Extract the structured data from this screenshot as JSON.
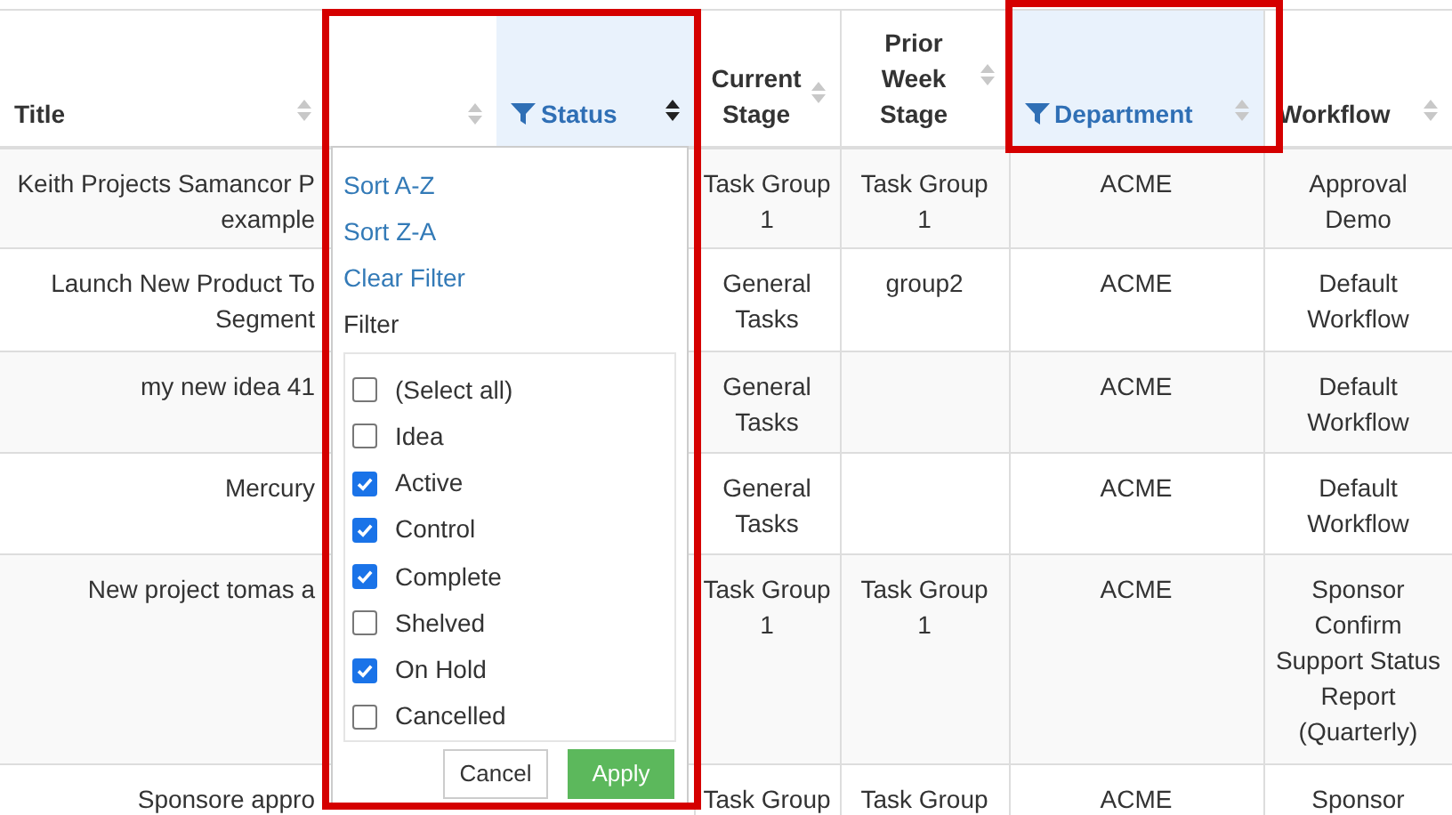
{
  "columns": [
    {
      "label": "Title",
      "filtered": false,
      "sorted": false
    },
    {
      "filtered": false,
      "sorted": false
    },
    {
      "label": "Status",
      "filtered": true,
      "sorted": true
    },
    {
      "label": "Current Stage",
      "filtered": false,
      "sorted": false
    },
    {
      "label": "Prior Week Stage",
      "filtered": false,
      "sorted": false
    },
    {
      "label": "Department",
      "filtered": true,
      "sorted": false
    },
    {
      "label": "Workflow",
      "filtered": false,
      "sorted": false
    }
  ],
  "rows": [
    {
      "title": "Keith Projects Samancor P example",
      "current_stage": "Task Group 1",
      "prior_week_stage": "Task Group 1",
      "department": "ACME",
      "workflow": "Approval Demo"
    },
    {
      "title": "Launch New Product To Segment",
      "current_stage": "General Tasks",
      "prior_week_stage": "group2",
      "department": "ACME",
      "workflow": "Default Workflow"
    },
    {
      "title": "my new idea 41",
      "current_stage": "General Tasks",
      "department": "ACME",
      "workflow": "Default Workflow"
    },
    {
      "title": "Mercury",
      "current_stage": "General Tasks",
      "department": "ACME",
      "workflow": "Default Workflow"
    },
    {
      "title": "New project tomas a",
      "current_stage": "Task Group 1",
      "prior_week_stage": "Task Group 1",
      "department": "ACME",
      "workflow": "Sponsor Confirm Support Status Report (Quarterly)"
    },
    {
      "title": "Sponsore appro",
      "current_stage": "Task Group",
      "prior_week_stage": "Task Group",
      "department": "ACME",
      "workflow": "Sponsor"
    }
  ],
  "filter_menu": {
    "actions": [
      "Sort A-Z",
      "Sort Z-A",
      "Clear Filter"
    ],
    "filter_label": "Filter",
    "options": [
      {
        "label": "(Select all)",
        "checked": false
      },
      {
        "label": "Idea",
        "checked": false
      },
      {
        "label": "Active",
        "checked": true
      },
      {
        "label": "Control",
        "checked": true
      },
      {
        "label": "Complete",
        "checked": true
      },
      {
        "label": "Shelved",
        "checked": false
      },
      {
        "label": "On Hold",
        "checked": true
      },
      {
        "label": "Cancelled",
        "checked": false
      }
    ],
    "cancel": "Cancel",
    "apply": "Apply"
  }
}
